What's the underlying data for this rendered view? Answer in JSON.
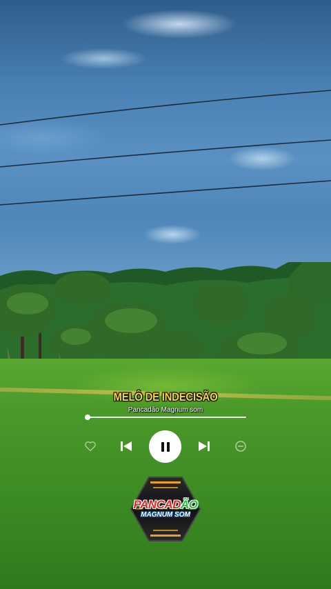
{
  "now_playing": {
    "title": "MELÔ DE INDECISÃO",
    "artist": "Pancadão Magnum som",
    "progress": 0.0
  },
  "controls": {
    "like_icon": "heart-outline-icon",
    "previous_icon": "skip-previous-icon",
    "play_state_icon": "pause-icon",
    "next_icon": "skip-next-icon",
    "remove_icon": "minus-circle-icon"
  },
  "logo": {
    "line1_main": "PANCAD",
    "line1_accent": "ÃO",
    "line2": "MAGNUM SOM"
  },
  "colors": {
    "title": "#f6d836",
    "artist": "#ffffff",
    "logo_red": "#e8262a",
    "logo_green": "#2bbf3c",
    "logo_blue": "#0a4e9a",
    "logo_amber": "#f0a020"
  }
}
